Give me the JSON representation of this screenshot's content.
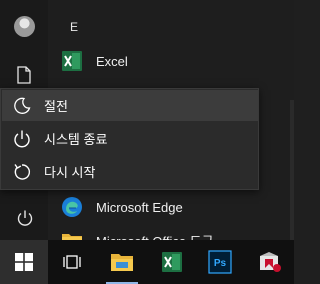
{
  "start_menu": {
    "section_letter": "E",
    "apps": [
      {
        "label": "Excel",
        "icon": "excel-icon"
      },
      {
        "label": "Microsoft Edge",
        "icon": "edge-icon"
      },
      {
        "label": "Microsoft Office 도구",
        "icon": "folder-icon"
      }
    ]
  },
  "power_menu": {
    "items": [
      {
        "label": "절전",
        "icon": "moon-icon"
      },
      {
        "label": "시스템 종료",
        "icon": "power-icon"
      },
      {
        "label": "다시 시작",
        "icon": "restart-icon"
      }
    ]
  },
  "taskbar": {
    "items": [
      "windows-logo-icon",
      "task-view-icon",
      "file-explorer-icon",
      "excel-icon",
      "photoshop-icon",
      "app-icon"
    ],
    "photoshop_text": "Ps"
  },
  "colors": {
    "excel_green": "#1d6f42",
    "photoshop_bg": "#001e36",
    "photoshop_text": "#31a8ff",
    "hover": "#3c3c3c"
  }
}
